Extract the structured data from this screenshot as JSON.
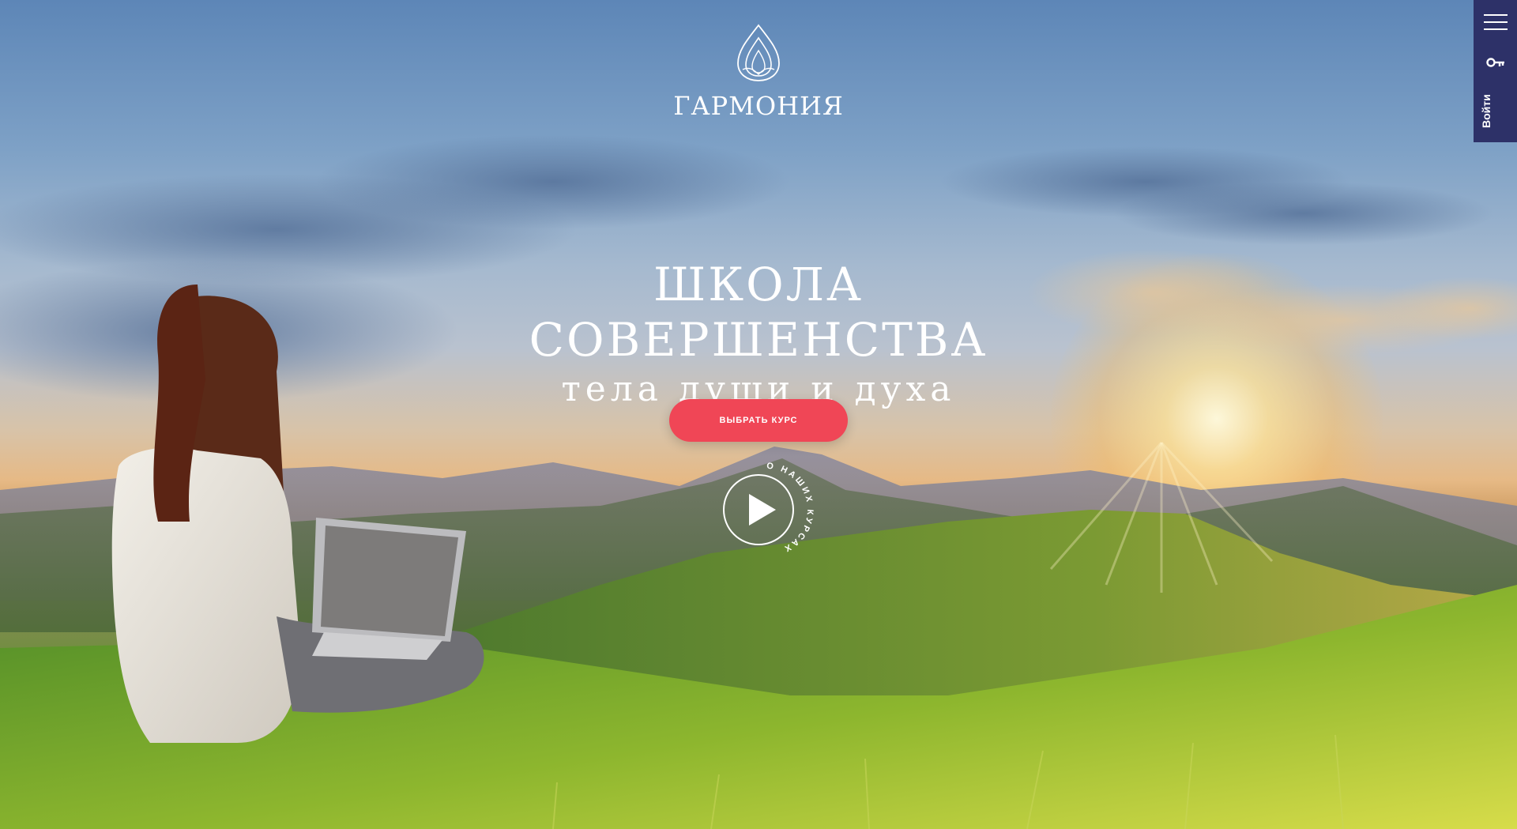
{
  "brand": {
    "name": "ГАРМОНИЯ",
    "logo_icon": "lotus-drop-icon"
  },
  "hero": {
    "title_line1": "ШКОЛА СОВЕРШЕНСТВА",
    "title_line2": "тела души и духа",
    "cta_label": "ВЫБРАТЬ КУРС",
    "video_label": "О НАШИХ КУРСАХ",
    "video_icon": "play-icon"
  },
  "side_nav": {
    "menu_icon": "hamburger-menu-icon",
    "login_label": "Войти",
    "login_icon": "key-icon"
  },
  "colors": {
    "cta": "#f04656",
    "side_panel": "#2d3168"
  }
}
